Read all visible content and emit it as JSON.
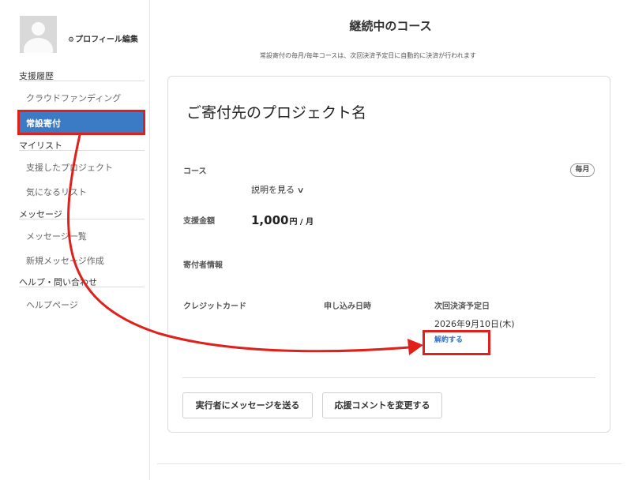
{
  "sidebar": {
    "profile_edit": "プロフィール編集",
    "sections": [
      {
        "heading": "支援履歴",
        "items": [
          "クラウドファンディング",
          "常設寄付"
        ]
      },
      {
        "heading": "マイリスト",
        "items": [
          "支援したプロジェクト",
          "気になるリスト"
        ]
      },
      {
        "heading": "メッセージ",
        "items": [
          "メッセージ一覧",
          "新規メッセージ作成"
        ]
      },
      {
        "heading": "ヘルプ・問い合わせ",
        "items": [
          "ヘルプページ"
        ]
      }
    ],
    "active_item": "常設寄付"
  },
  "main": {
    "title": "継続中のコース",
    "note": "常設寄付の毎月/毎年コースは、次回決済予定日に自動的に決済が行われます"
  },
  "card": {
    "project_name": "ご寄付先のプロジェクト名",
    "course_label": "コース",
    "course_badge": "毎月",
    "explain_link": "説明を見る",
    "amount_label": "支援金額",
    "amount_value": "1,000",
    "amount_unit": "円 / 月",
    "donor_info_label": "寄付者情報",
    "credit_card_label": "クレジットカード",
    "applied_date_label": "申し込み日時",
    "next_payment_label": "次回決済予定日",
    "next_payment_date": "2026年9月10日(木)",
    "cancel_link": "解約する",
    "buttons": {
      "message": "実行者にメッセージを送る",
      "comment": "応援コメントを変更する"
    }
  },
  "colors": {
    "accent": "#3b7bc6",
    "annotation": "#e0211b",
    "link": "#2e73c9"
  },
  "icons": [
    "gear-icon",
    "chevron-down-icon",
    "avatar-placeholder"
  ]
}
